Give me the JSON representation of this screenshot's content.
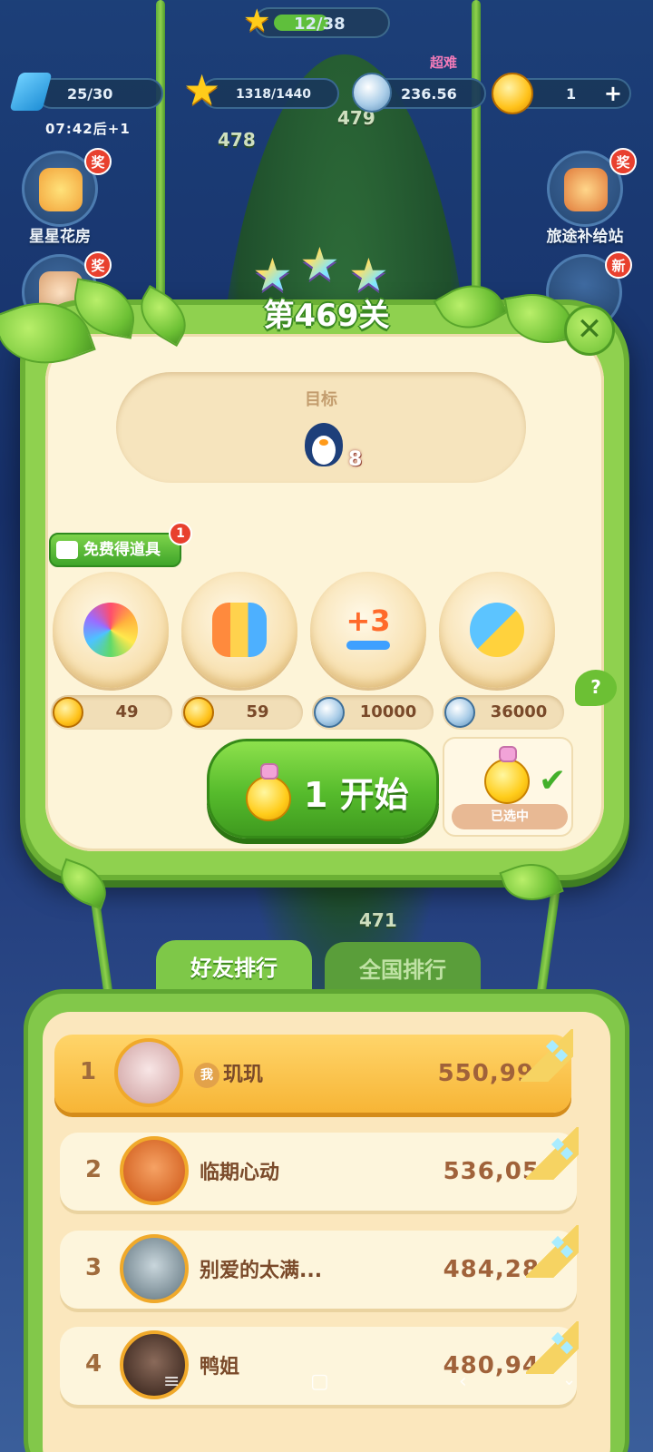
{
  "hud": {
    "stars_progress": "12/38",
    "energy": "25/30",
    "energy_timer": "07:42后+1",
    "star_points": "1318/1440",
    "silver_coins": "236.56",
    "gold_coins": "1",
    "difficulty_tag": "超难"
  },
  "side_buttons": {
    "left": {
      "label": "星星花房",
      "badge": "奖"
    },
    "right": {
      "label": "旅途补给站",
      "badge": "奖"
    },
    "left2_badge": "奖",
    "right2_badge": "新"
  },
  "map_levels": [
    "478",
    "479",
    "471"
  ],
  "level": {
    "stars_earned": 3,
    "title": "第469关",
    "goal_label": "目标",
    "goal_icon": "penguin-icon",
    "goal_count": "8",
    "free_props_label": "免费得道具",
    "free_props_badge": "1",
    "boosters": [
      {
        "icon": "rainbow-owl-icon",
        "currency": "gold",
        "price": "49"
      },
      {
        "icon": "rocket-bundle-icon",
        "currency": "gold",
        "price": "59"
      },
      {
        "icon": "plus-3-moves-icon",
        "currency": "silver",
        "price": "10000"
      },
      {
        "icon": "swap-animals-icon",
        "currency": "silver",
        "price": "36000"
      }
    ],
    "help_label": "?",
    "start_label": "1 开始",
    "selected_label": "已选中"
  },
  "ranking": {
    "tabs": [
      "好友排行",
      "全国排行"
    ],
    "active_tab": 0,
    "me_tag": "我",
    "rows": [
      {
        "rank": "1",
        "name": "玑玑",
        "score": "550,990",
        "me": true
      },
      {
        "rank": "2",
        "name": "临期心动",
        "score": "536,055",
        "me": false
      },
      {
        "rank": "3",
        "name": "别爱的太满...",
        "score": "484,285",
        "me": false
      },
      {
        "rank": "4",
        "name": "鸭姐",
        "score": "480,945",
        "me": false
      }
    ]
  },
  "colors": {
    "accent_green": "#7ec848",
    "panel_cream": "#fdf4d8",
    "gold": "#ffcc1a",
    "highlight_row": "#ffd56a"
  }
}
